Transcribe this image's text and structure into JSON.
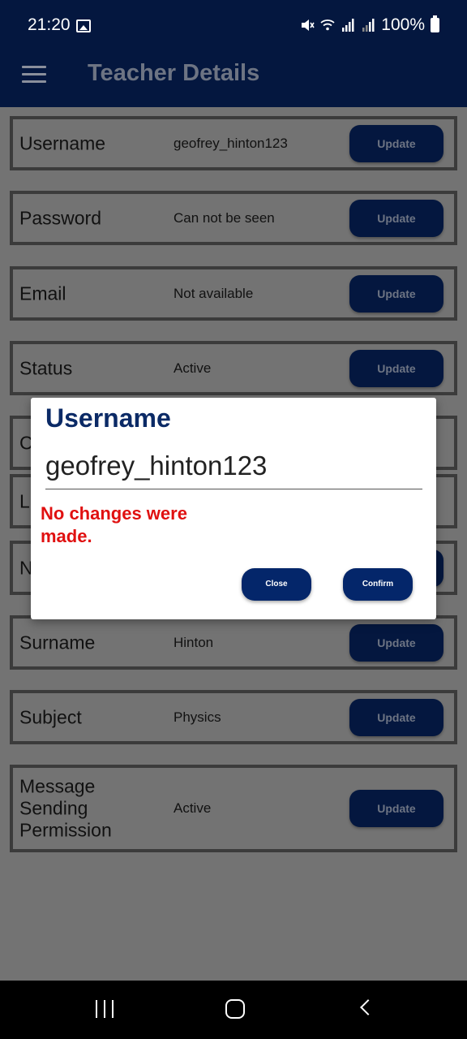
{
  "status_bar": {
    "time": "21:20",
    "battery": "100%",
    "icons": [
      "gallery-icon",
      "mute-icon",
      "wifi-icon",
      "signal-icon",
      "signal-icon",
      "battery-icon"
    ]
  },
  "app_bar": {
    "title": "Teacher Details",
    "menu_icon": "hamburger-icon"
  },
  "rows": [
    {
      "label": "Username",
      "value": "geofrey_hinton123",
      "button": "Update"
    },
    {
      "label": "Password",
      "value": "Can not be seen",
      "button": "Update"
    },
    {
      "label": "Email",
      "value": "Not available",
      "button": "Update"
    },
    {
      "label": "Status",
      "value": "Active",
      "button": "Update"
    },
    {
      "label": "C",
      "value": "",
      "button": ""
    },
    {
      "label": "L",
      "value": "",
      "button": ""
    },
    {
      "label": "N",
      "value": "",
      "button": ""
    },
    {
      "label": "Surname",
      "value": "Hinton",
      "button": "Update"
    },
    {
      "label": "Subject",
      "value": "Physics",
      "button": "Update"
    },
    {
      "label": "Message Sending Permission",
      "value": "Active",
      "button": "Update"
    }
  ],
  "dialog": {
    "title": "Username",
    "input_value": "geofrey_hinton123",
    "error": "No changes were made.",
    "close_label": "Close",
    "confirm_label": "Confirm"
  },
  "nav_bar": {
    "icons": [
      "recent-apps-icon",
      "home-icon",
      "back-icon"
    ]
  },
  "colors": {
    "primary": "#04173f",
    "dialog_title": "#0b2a66",
    "error": "#e01010",
    "scrim_background": "#737373"
  }
}
